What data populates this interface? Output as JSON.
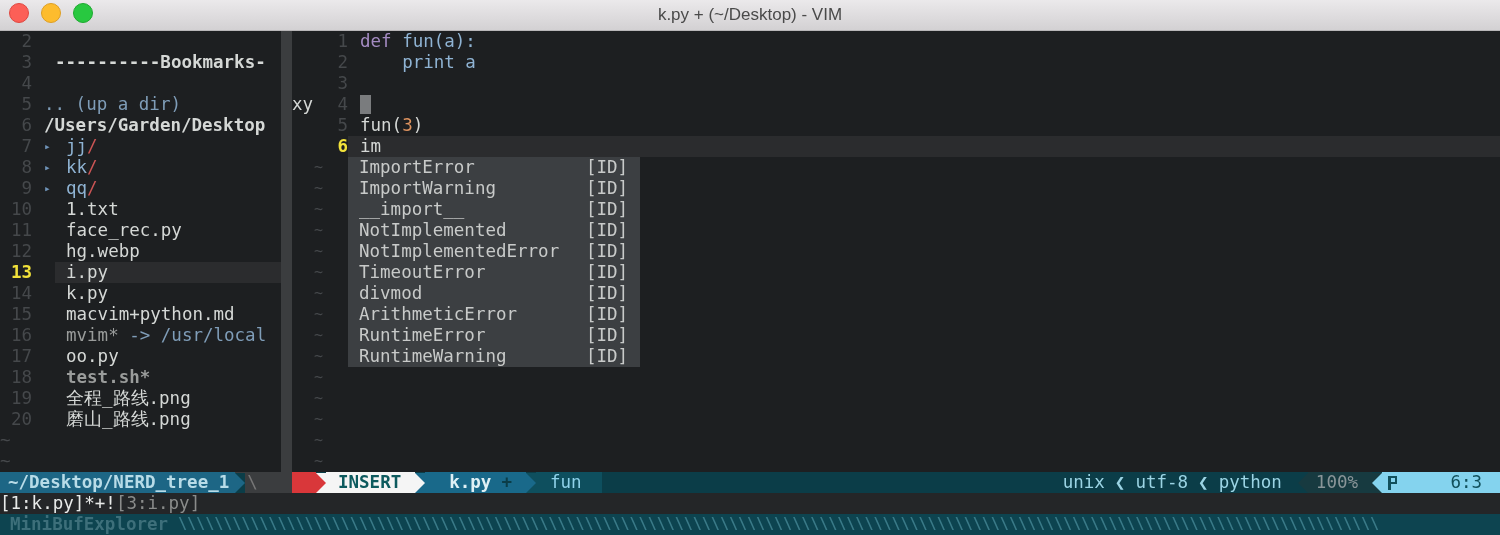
{
  "window": {
    "title": "k.py + (~/Desktop) - VIM"
  },
  "tree": {
    "lines": [
      {
        "number": "2",
        "kind": "blank",
        "selected": false
      },
      {
        "number": "3",
        "kind": "bookmarks",
        "text": "----------Bookmarks-",
        "selected": false
      },
      {
        "number": "4",
        "kind": "blank",
        "selected": false
      },
      {
        "number": "5",
        "kind": "updir",
        "text": ".. (up a dir)",
        "selected": false
      },
      {
        "number": "6",
        "kind": "root",
        "text": "/Users/Garden/Desktop",
        "selected": false
      },
      {
        "number": "7",
        "kind": "dir",
        "arrow": "▸",
        "name": "jj",
        "suffix": "/",
        "selected": false
      },
      {
        "number": "8",
        "kind": "dir",
        "arrow": "▸",
        "name": "kk",
        "suffix": "/",
        "selected": false
      },
      {
        "number": "9",
        "kind": "dir",
        "arrow": "▸",
        "name": "qq",
        "suffix": "/",
        "selected": false
      },
      {
        "number": "10",
        "kind": "file",
        "text": "1.txt",
        "selected": false
      },
      {
        "number": "11",
        "kind": "file",
        "text": "face_rec.py",
        "selected": false
      },
      {
        "number": "12",
        "kind": "file",
        "text": "hg.webp",
        "selected": false
      },
      {
        "number": "13",
        "kind": "file",
        "text": "i.py",
        "selected": true
      },
      {
        "number": "14",
        "kind": "file",
        "text": "k.py",
        "selected": false
      },
      {
        "number": "15",
        "kind": "file",
        "text": "macvim+python.md",
        "selected": false
      },
      {
        "number": "16",
        "kind": "link",
        "name": "mvim*",
        "target": "-> /usr/local",
        "selected": false
      },
      {
        "number": "17",
        "kind": "file",
        "text": "oo.py",
        "selected": false
      },
      {
        "number": "18",
        "kind": "exec",
        "text": "test.sh*",
        "selected": false
      },
      {
        "number": "19",
        "kind": "file",
        "text": "全程_路线.png",
        "selected": false
      },
      {
        "number": "20",
        "kind": "file",
        "text": "磨山_路线.png",
        "selected": false
      }
    ],
    "filler": [
      "~",
      "~"
    ]
  },
  "stray_text": "xy",
  "editor": {
    "lines": [
      {
        "number": "1",
        "selected": false,
        "cursor": false,
        "tokens": [
          {
            "text": "def",
            "kind": "keyword"
          },
          {
            "text": " fun(a):",
            "kind": "name"
          }
        ]
      },
      {
        "number": "2",
        "selected": false,
        "cursor": false,
        "tokens": [
          {
            "text": "    print a",
            "kind": "name"
          }
        ]
      },
      {
        "number": "3",
        "selected": false,
        "cursor": false
      },
      {
        "number": "4",
        "selected": false,
        "cursor": true
      },
      {
        "number": "5",
        "selected": false,
        "cursor": false,
        "tokens": [
          {
            "text": "fun(",
            "kind": "plain"
          },
          {
            "text": "3",
            "kind": "number"
          },
          {
            "text": ")",
            "kind": "plain"
          }
        ]
      },
      {
        "number": "6",
        "selected": true,
        "cursor": false,
        "tokens": [
          {
            "text": "im",
            "kind": "plain"
          }
        ]
      }
    ],
    "filler": [
      "~",
      "~",
      "~",
      "~",
      "~",
      "~",
      "~",
      "~",
      "~",
      "~",
      "~",
      "~",
      "~",
      "~",
      "~"
    ]
  },
  "completion": {
    "items": [
      {
        "word": "ImportError",
        "tag": "[ID]"
      },
      {
        "word": "ImportWarning",
        "tag": "[ID]"
      },
      {
        "word": "__import__",
        "tag": "[ID]"
      },
      {
        "word": "NotImplemented",
        "tag": "[ID]"
      },
      {
        "word": "NotImplementedError",
        "tag": "[ID]"
      },
      {
        "word": "TimeoutError",
        "tag": "[ID]"
      },
      {
        "word": "divmod",
        "tag": "[ID]"
      },
      {
        "word": "ArithmeticError",
        "tag": "[ID]"
      },
      {
        "word": "RuntimeError",
        "tag": "[ID]"
      },
      {
        "word": "RuntimeWarning",
        "tag": "[ID]"
      }
    ]
  },
  "status_bar": {
    "tree_path": "~/Desktop/NERD_tree_1",
    "tree_fill": "\\",
    "mode": "INSERT",
    "file": "k.py",
    "modified": "+",
    "function": "fun",
    "fileformat": "unix",
    "separator_1": "❮",
    "encoding": "utf-8",
    "separator_2": "❮",
    "filetype": "python",
    "percent": "100%",
    "position": "6:3"
  },
  "buffer_line": {
    "current": "[1:k.py]*+!",
    "other": "[3:i.py]"
  },
  "minibuf_status": {
    "name": "MiniBufExplorer",
    "fill": "\\\\\\\\\\\\\\\\\\\\\\\\\\\\\\\\\\\\\\\\\\\\\\\\\\\\\\\\\\\\\\\\\\\\\\\\\\\\\\\\\\\\\\\\\\\\\\\\\\\\\\\\\\\\\\\\\\\\\\\\\\\\\\\\\\\\\\\\\\\\\\\\\\\\\\\\\\\\\\\\\\\\\\\\\\\\\\\\\\\\\\\\\\\\\\\\\\\\\\\\\\\\\\\\\\\\\\\\\\\\\\\\\\\\\\\\\\\\\\\\\\\\\\\\\\\\\\\\\\\\\\\\\\"
  }
}
